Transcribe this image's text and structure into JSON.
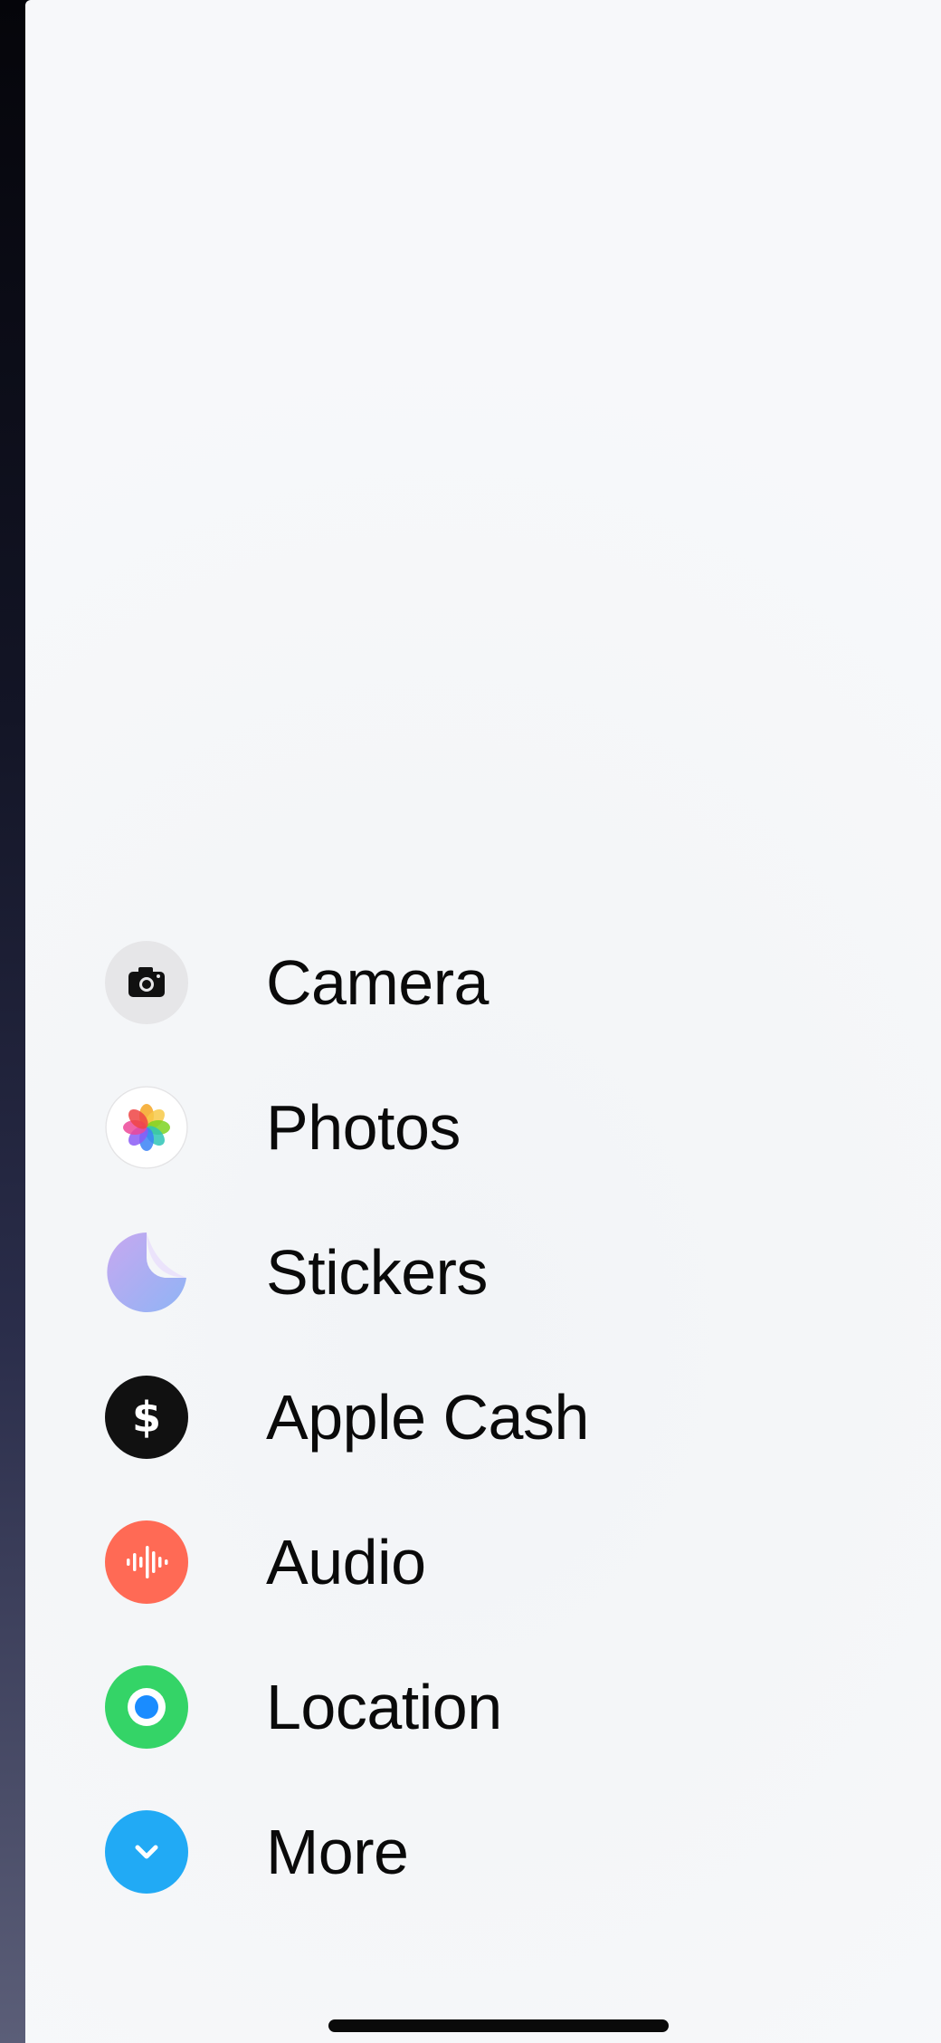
{
  "menu": {
    "items": [
      {
        "label": "Camera",
        "icon": "camera-icon"
      },
      {
        "label": "Photos",
        "icon": "photos-icon"
      },
      {
        "label": "Stickers",
        "icon": "stickers-icon"
      },
      {
        "label": "Apple Cash",
        "icon": "apple-cash-icon"
      },
      {
        "label": "Audio",
        "icon": "audio-icon"
      },
      {
        "label": "Location",
        "icon": "location-icon"
      },
      {
        "label": "More",
        "icon": "chevron-down-icon"
      }
    ]
  },
  "colors": {
    "camera_bg": "#e6e6e8",
    "cash_bg": "#111111",
    "audio_bg": "#ff6a55",
    "location_bg": "#34d467",
    "location_dot": "#1a8cff",
    "more_bg": "#21aaf5",
    "text": "#0a0a0a"
  }
}
